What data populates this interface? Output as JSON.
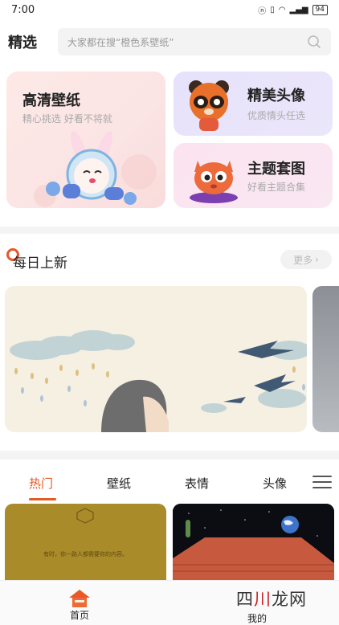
{
  "status": {
    "time": "7:00",
    "battery": "94"
  },
  "header": {
    "title": "精选",
    "search_placeholder": "大家都在搜“橙色系壁纸”"
  },
  "features": {
    "wallpaper": {
      "title": "高清壁纸",
      "subtitle": "精心挑选 好看不将就"
    },
    "avatar": {
      "title": "精美头像",
      "subtitle": "优质情头任选"
    },
    "theme": {
      "title": "主题套图",
      "subtitle": "好看主题合集"
    }
  },
  "daily": {
    "title": "每日上新",
    "more_label": "更多"
  },
  "tabs": [
    "热门",
    "壁纸",
    "表情",
    "头像"
  ],
  "thumbs": {
    "thumb1_caption": "有时，你一路人都需要你的内容。"
  },
  "bottom_nav": {
    "home": "首页",
    "mine": "我的"
  },
  "watermark": {
    "text_a": "四",
    "text_b": "川",
    "text_c": "龙网"
  },
  "colors": {
    "accent": "#e35a22"
  }
}
